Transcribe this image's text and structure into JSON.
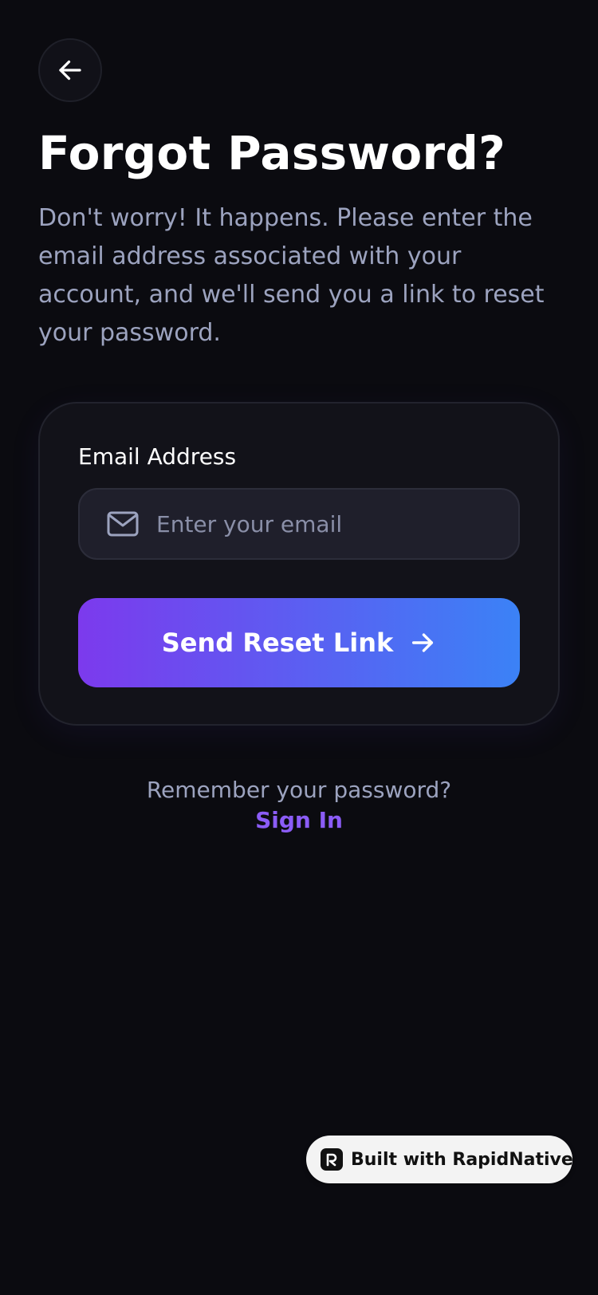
{
  "header": {
    "back_icon": "arrow-left-icon",
    "title": "Forgot Password?",
    "subtitle": "Don't worry! It happens. Please enter the email address associated with your account, and we'll send you a link to reset your password."
  },
  "form": {
    "email_label": "Email Address",
    "email_icon": "mail-icon",
    "email_placeholder": "Enter your email",
    "email_value": "",
    "submit_label": "Send Reset Link",
    "submit_icon": "arrow-right-icon"
  },
  "footer": {
    "remember_text": "Remember your password?",
    "signin_label": "Sign In"
  },
  "badge": {
    "logo_icon": "rapidnative-logo-icon",
    "text": "Built with RapidNative"
  },
  "colors": {
    "background": "#0b0b10",
    "card": "#121219",
    "input": "#1f1f2b",
    "gradient_start": "#7c3aed",
    "gradient_end": "#3b82f6",
    "link": "#8b5cf6",
    "muted_text": "#9ca3bf"
  }
}
